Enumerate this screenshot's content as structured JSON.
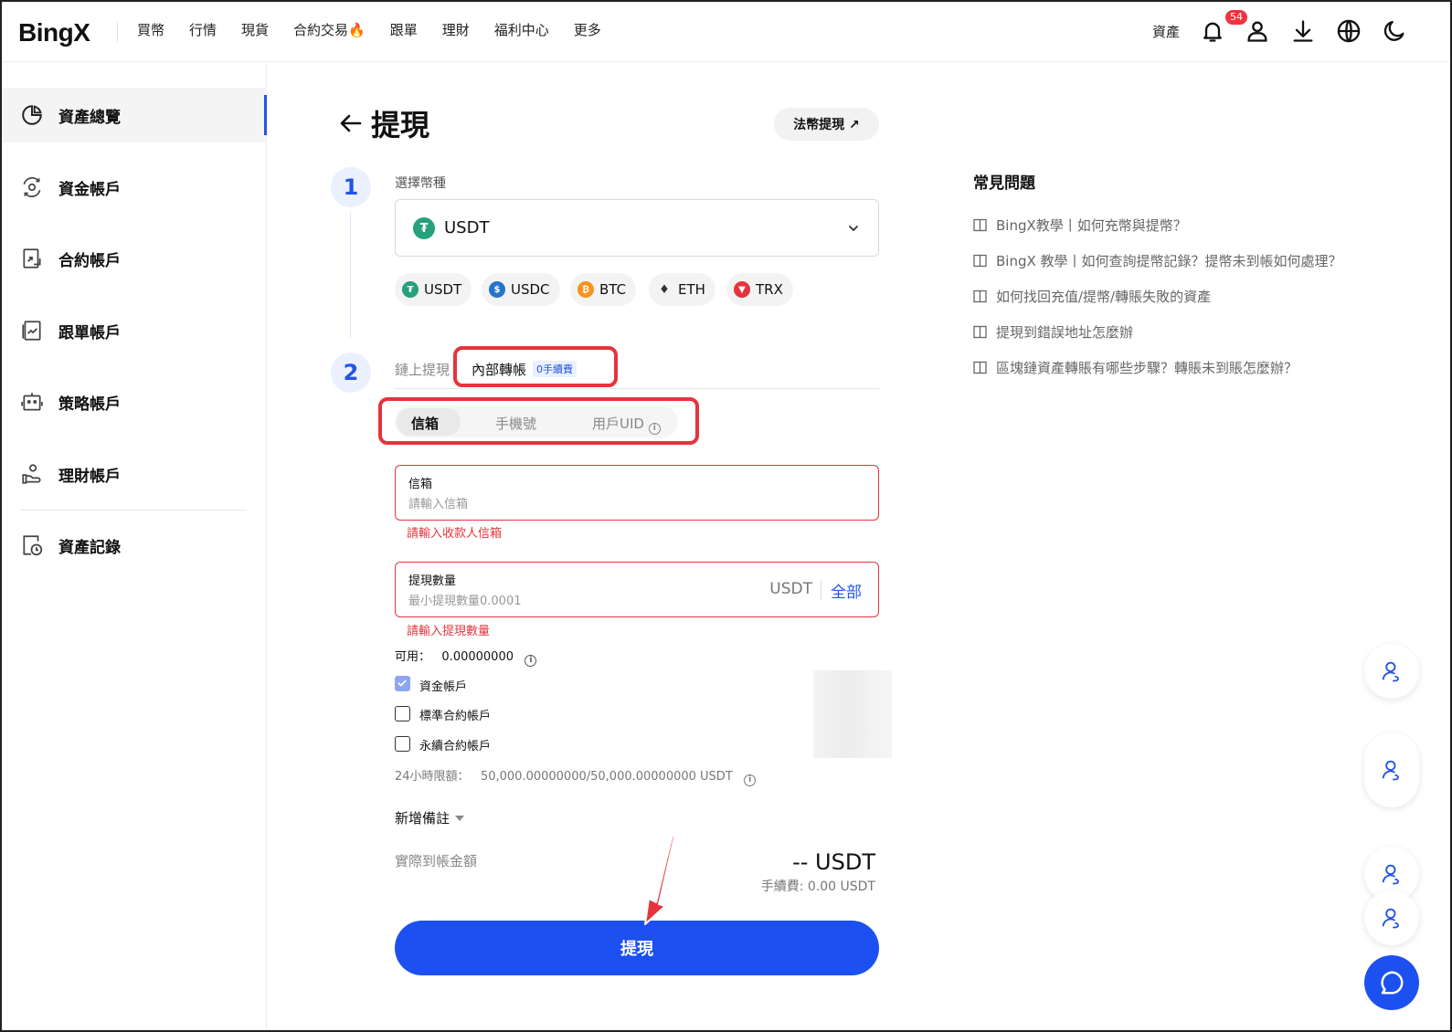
{
  "brand": {
    "logo": "BingX",
    "accent": "#1c50f0",
    "error": "#e5343d"
  },
  "nav": {
    "links": [
      "買幣",
      "行情",
      "現貨",
      "合約交易🔥",
      "跟單",
      "理財",
      "福利中心",
      "更多"
    ],
    "assets": "資產",
    "notifications_count": "54",
    "icons": [
      "bell-icon",
      "user-icon",
      "download-icon",
      "globe-icon",
      "moon-icon"
    ]
  },
  "sidebar": {
    "items": [
      {
        "label": "資產總覽",
        "icon": "pie-chart-icon",
        "active": true
      },
      {
        "label": "資金帳戶",
        "icon": "fund-account-icon"
      },
      {
        "label": "合約帳戶",
        "icon": "contract-account-icon"
      },
      {
        "label": "跟單帳戶",
        "icon": "copy-trade-account-icon"
      },
      {
        "label": "策略帳戶",
        "icon": "strategy-bot-icon"
      },
      {
        "label": "理財帳戶",
        "icon": "wealth-hand-icon"
      },
      {
        "label": "資產記錄",
        "icon": "record-clock-icon"
      }
    ]
  },
  "page": {
    "title": "提現",
    "fiat_button": "法幣提現 ↗"
  },
  "step1": {
    "number": "1",
    "label": "選擇幣種",
    "selected_coin": "USDT",
    "quick_coins": [
      "USDT",
      "USDC",
      "BTC",
      "ETH",
      "TRX"
    ]
  },
  "step2": {
    "number": "2",
    "tabs": {
      "onchain": "鏈上提現",
      "internal": "內部轉帳",
      "fee_tag": "0手續費"
    },
    "recipient_types": [
      "信箱",
      "手機號",
      "用戶UID"
    ],
    "email_field": {
      "label": "信箱",
      "placeholder": "請輸入信箱",
      "error": "請輸入收款人信箱"
    },
    "amount_field": {
      "label": "提現數量",
      "placeholder": "最小提現數量0.0001",
      "unit": "USDT",
      "all": "全部",
      "error": "請輸入提現數量"
    },
    "available_label": "可用：",
    "available_value": "0.00000000",
    "accounts": [
      {
        "label": "資金帳戶",
        "checked": true
      },
      {
        "label": "標準合約帳戶",
        "checked": false
      },
      {
        "label": "永續合約帳戶",
        "checked": false
      }
    ],
    "limit_label": "24小時限額：",
    "limit_value": "50,000.00000000/50,000.00000000 USDT",
    "memo": "新增備註",
    "received_label": "實際到帳金額",
    "received_amount": "-- USDT",
    "fee": "手續費: 0.00 USDT",
    "submit": "提現"
  },
  "faq": {
    "title": "常見問題",
    "items": [
      "BingX教學丨如何充幣與提幣？",
      "BingX 教學丨如何查詢提幣記錄？提幣未到帳如何處理？",
      "如何找回充值/提幣/轉賬失敗的資產",
      "提現到錯誤地址怎麼辦",
      "區塊鏈資產轉賬有哪些步驟？轉賬未到賬怎麼辦？"
    ]
  }
}
